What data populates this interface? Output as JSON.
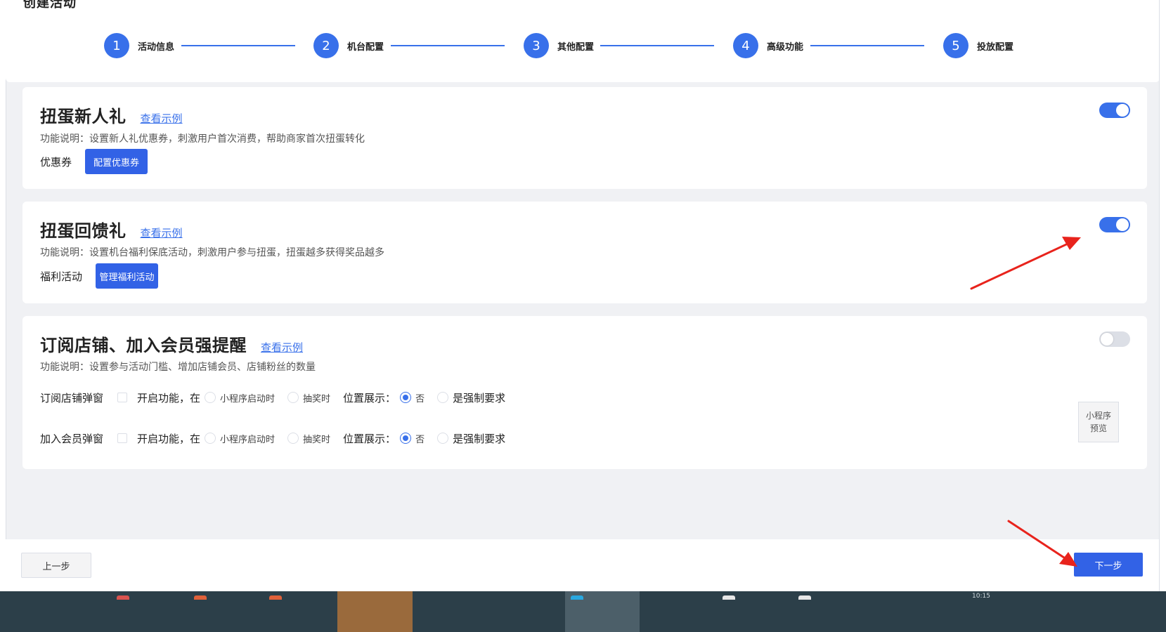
{
  "page": {
    "title": "创建活动"
  },
  "stepper": {
    "steps": [
      {
        "num": "1",
        "label": "活动信息"
      },
      {
        "num": "2",
        "label": "机台配置"
      },
      {
        "num": "3",
        "label": "其他配置"
      },
      {
        "num": "4",
        "label": "高级功能"
      },
      {
        "num": "5",
        "label": "投放配置"
      }
    ]
  },
  "cards": {
    "new_user_gift": {
      "title": "扭蛋新人礼",
      "example_link": "查看示例",
      "description": "功能说明：设置新人礼优惠券，刺激用户首次消费，帮助商家首次扭蛋转化",
      "row_label": "优惠券",
      "button_label": "配置优惠券",
      "enabled": true
    },
    "feedback_gift": {
      "title": "扭蛋回馈礼",
      "example_link": "查看示例",
      "description": "功能说明：设置机台福利保底活动，刺激用户参与扭蛋，扭蛋越多获得奖品越多",
      "row_label": "福利活动",
      "button_label": "管理福利活动",
      "enabled": true
    },
    "subscribe_reminder": {
      "title": "订阅店铺、加入会员强提醒",
      "example_link": "查看示例",
      "description": "功能说明：设置参与活动门槛、增加店铺会员、店铺粉丝的数量",
      "enabled": false,
      "rows": [
        {
          "label": "订阅店铺弹窗",
          "enable_text": "开启功能，在",
          "enabled": false,
          "timing_options": [
            "小程序启动时",
            "抽奖时"
          ],
          "position_label": "位置展示：",
          "position_options": [
            "否",
            "是强制要求"
          ],
          "position_selected": "否"
        },
        {
          "label": "加入会员弹窗",
          "enable_text": "开启功能，在",
          "enabled": false,
          "timing_options": [
            "小程序启动时",
            "抽奖时"
          ],
          "position_label": "位置展示：",
          "position_options": [
            "否",
            "是强制要求"
          ],
          "position_selected": "否"
        }
      ],
      "preview": {
        "line1": "小程序",
        "line2": "预览"
      }
    }
  },
  "footer": {
    "prev_label": "上一步",
    "next_label": "下一步"
  },
  "taskbar": {
    "clock": "10:15"
  },
  "colors": {
    "primary": "#3870ea",
    "button_blue": "#3262e6",
    "background": "#f0f1f4",
    "annotation_red": "#e8231c"
  }
}
